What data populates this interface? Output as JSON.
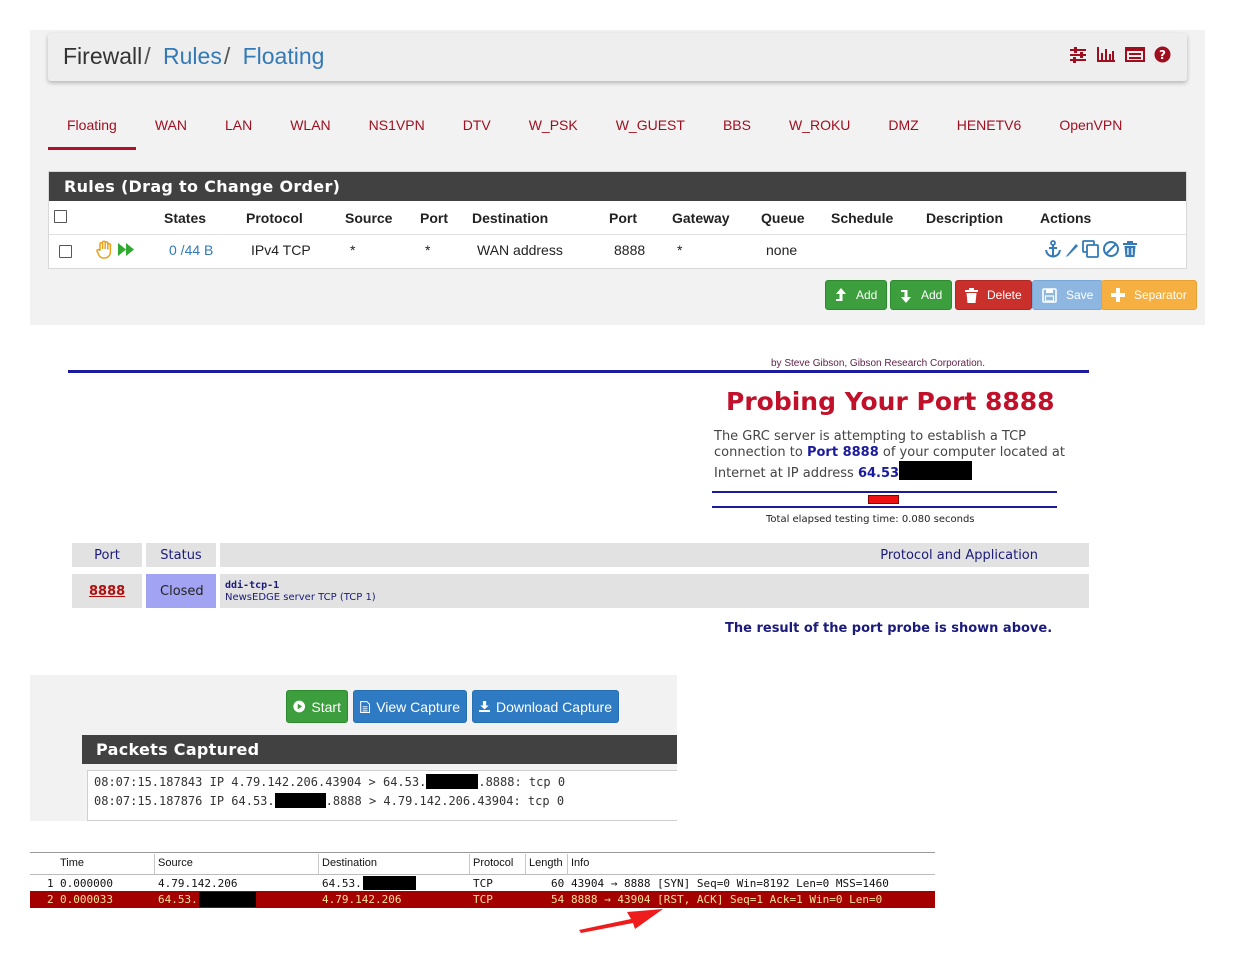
{
  "firewall": {
    "breadcrumb": [
      "Firewall",
      "Rules",
      "Floating"
    ],
    "breadcrumb_sep": "/",
    "header_icons": [
      "sliders-icon",
      "bar-chart-icon",
      "list-icon",
      "help-icon"
    ],
    "tabs": [
      "Floating",
      "WAN",
      "LAN",
      "WLAN",
      "NS1VPN",
      "DTV",
      "W_PSK",
      "W_GUEST",
      "BBS",
      "W_ROKU",
      "DMZ",
      "HENETV6",
      "OpenVPN"
    ],
    "active_tab": "Floating",
    "panel_title": "Rules (Drag to Change Order)",
    "columns": [
      "States",
      "Protocol",
      "Source",
      "Port",
      "Destination",
      "Port",
      "Gateway",
      "Queue",
      "Schedule",
      "Description",
      "Actions"
    ],
    "rule": {
      "states": "0 /44 B",
      "protocol": "IPv4 TCP",
      "source": "*",
      "source_port": "*",
      "destination": "WAN address",
      "destination_port": "8888",
      "gateway": "*",
      "queue": "none",
      "schedule": "",
      "description": ""
    },
    "buttons": {
      "add_top": "Add",
      "add_bottom": "Add",
      "delete": "Delete",
      "save": "Save",
      "separator": "Separator"
    },
    "colors": {
      "accent": "#9e0e1f",
      "link": "#337ab7",
      "panel_header": "#414141",
      "green": "#3c9e3c",
      "red": "#c9302c",
      "orange": "#f5b041"
    }
  },
  "grc": {
    "credit": "by Steve Gibson,  Gibson Research Corporation.",
    "title": "Probing Your Port 8888",
    "desc_1": "The GRC server is attempting to establish a TCP connection to ",
    "desc_port": "Port 8888",
    "desc_2": " of your computer located at Internet at IP address ",
    "desc_ip": "64.53",
    "elapsed": "Total elapsed testing time: 0.080 seconds",
    "table_headers": {
      "port": "Port",
      "status": "Status",
      "protocol": "Protocol and Application"
    },
    "row": {
      "port": "8888",
      "status": "Closed",
      "service": "ddi-tcp-1",
      "service_desc": "NewsEDGE server TCP (TCP 1)"
    },
    "result": "The result of the port probe is shown above."
  },
  "capture": {
    "buttons": {
      "start": "Start",
      "view": "View Capture",
      "download": "Download Capture"
    },
    "title": "Packets Captured",
    "lines": [
      {
        "pre": "08:07:15.187843 IP 4.79.142.206.43904 > 64.53.",
        "post": ".8888: tcp 0"
      },
      {
        "pre": "08:07:15.187876 IP 64.53.",
        "post": ".8888 > 4.79.142.206.43904: tcp 0"
      }
    ]
  },
  "wireshark": {
    "columns": [
      "Time",
      "Source",
      "Destination",
      "Protocol",
      "Length",
      "Info"
    ],
    "rows": [
      {
        "no": "1",
        "time": "0.000000",
        "source": "4.79.142.206",
        "destination": "64.53.",
        "protocol": "TCP",
        "length": "60",
        "info": "43904 → 8888 [SYN] Seq=0 Win=8192 Len=0 MSS=1460"
      },
      {
        "no": "2",
        "time": "0.000033",
        "source": "64.53.",
        "destination": "4.79.142.206",
        "protocol": "TCP",
        "length": "54",
        "info": "8888 → 43904 [RST, ACK] Seq=1 Ack=1 Win=0 Len=0"
      }
    ],
    "highlight_color": "#a40000"
  }
}
